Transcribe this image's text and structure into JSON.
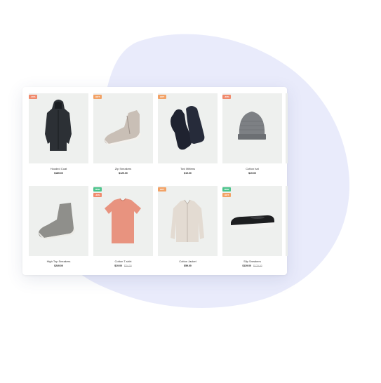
{
  "colors": {
    "blob": "#e9ebfb",
    "sale": "#f08a6c",
    "new": "#4cc48c",
    "hot": "#f2a266"
  },
  "products": [
    {
      "name": "Hooded Coat",
      "price": "$189.00",
      "old_price": "",
      "badges": [
        {
          "label": "-20%",
          "kind": "sale"
        }
      ],
      "icon": "coat-icon"
    },
    {
      "name": "Zip Sneakers",
      "price": "$129.00",
      "old_price": "",
      "badges": [
        {
          "label": "HOT",
          "kind": "hot"
        }
      ],
      "icon": "sneaker-icon"
    },
    {
      "name": "Tovi Mittens",
      "price": "$19.00",
      "old_price": "",
      "badges": [
        {
          "label": "HOT",
          "kind": "hot"
        }
      ],
      "icon": "mittens-icon"
    },
    {
      "name": "Cotton hat",
      "price": "$19.00",
      "old_price": "",
      "badges": [
        {
          "label": "-20%",
          "kind": "sale"
        }
      ],
      "icon": "beanie-icon"
    },
    {
      "name": "High Top Sneakers",
      "price": "$249.00",
      "old_price": "",
      "badges": [],
      "icon": "boot-icon"
    },
    {
      "name": "Cotton T-shirt",
      "price": "$19.00",
      "old_price": "$24.00",
      "badges": [
        {
          "label": "NEW",
          "kind": "new"
        },
        {
          "label": "-20%",
          "kind": "sale"
        }
      ],
      "icon": "tshirt-icon"
    },
    {
      "name": "Cotton Jacket",
      "price": "$59.00",
      "old_price": "",
      "badges": [
        {
          "label": "HOT",
          "kind": "hot"
        }
      ],
      "icon": "jacket-icon"
    },
    {
      "name": "Slip Sneakers",
      "price": "$129.00",
      "old_price": "$179.00",
      "badges": [
        {
          "label": "NEW",
          "kind": "new"
        },
        {
          "label": "HOT",
          "kind": "hot"
        }
      ],
      "icon": "slipon-icon"
    }
  ]
}
